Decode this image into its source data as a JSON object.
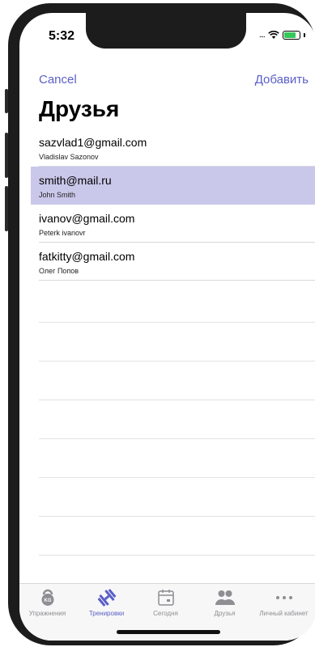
{
  "status_bar": {
    "time": "5:32",
    "dots": "....",
    "battery_color": "#35c759"
  },
  "nav": {
    "cancel_label": "Cancel",
    "add_label": "Добавить"
  },
  "page": {
    "title": "Друзья"
  },
  "friends": [
    {
      "email": "sazvlad1@gmail.com",
      "name": "Vladislav Sazonov",
      "selected": false
    },
    {
      "email": "smith@mail.ru",
      "name": "John Smith",
      "selected": true
    },
    {
      "email": "ivanov@gmail.com",
      "name": "Peterk ivanovr",
      "selected": false
    },
    {
      "email": "fatkitty@gmail.com",
      "name": "Олег Попов",
      "selected": false
    }
  ],
  "tabs": [
    {
      "label": "Упражнения",
      "icon": "kettlebell-icon",
      "active": false
    },
    {
      "label": "Тренировки",
      "icon": "dumbbell-icon",
      "active": true
    },
    {
      "label": "Сегодня",
      "icon": "calendar-icon",
      "active": false
    },
    {
      "label": "Друзья",
      "icon": "people-icon",
      "active": false
    },
    {
      "label": "Личный кабинет",
      "icon": "more-icon",
      "active": false
    }
  ],
  "colors": {
    "accent": "#5b5fc7",
    "selected_row": "#c9c8ea",
    "inactive": "#8e8e93"
  }
}
